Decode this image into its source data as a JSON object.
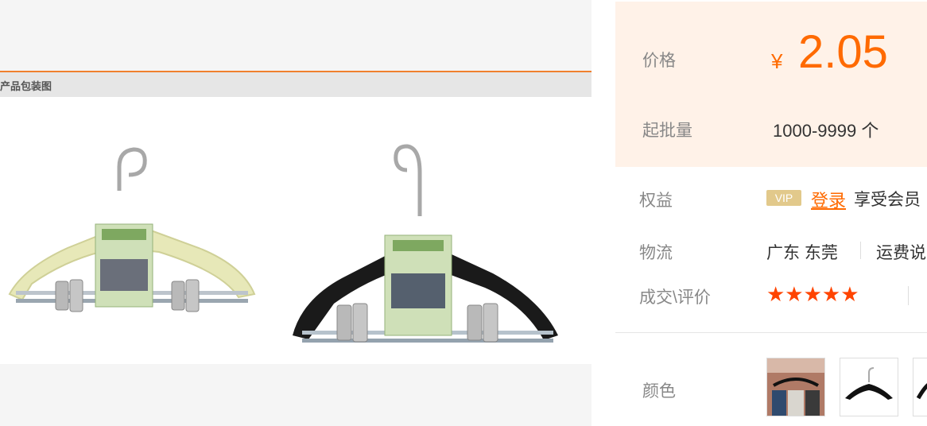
{
  "description": {
    "caption": "产品包装图"
  },
  "offer": {
    "price_label": "价格",
    "currency_symbol": "¥",
    "price": "2.05",
    "moq_label": "起批量",
    "moq_value": "1000-9999 个",
    "rights_label": "权益",
    "vip_badge": "VIP",
    "login_link": "登录",
    "member_text": "享受会员",
    "logistics_label": "物流",
    "location": "广东 东莞",
    "freight_text": "运费说",
    "deal_label": "成交\\评价",
    "stars": "★★★★★",
    "color_label": "颜色"
  },
  "colors": {
    "accent": "#ff6a00",
    "price_bg": "#fff2e8",
    "stars": "#ff4400"
  }
}
